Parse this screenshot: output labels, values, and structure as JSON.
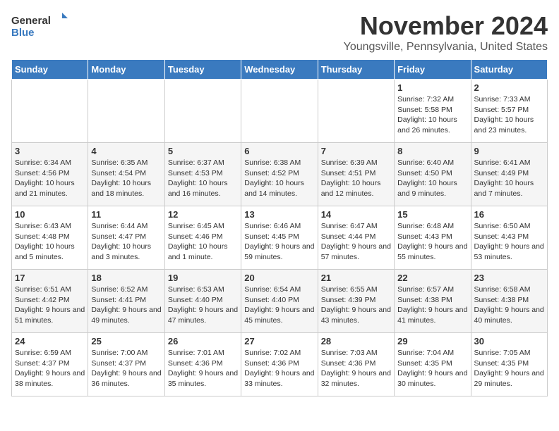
{
  "logo": {
    "general": "General",
    "blue": "Blue"
  },
  "header": {
    "month": "November 2024",
    "location": "Youngsville, Pennsylvania, United States"
  },
  "days_of_week": [
    "Sunday",
    "Monday",
    "Tuesday",
    "Wednesday",
    "Thursday",
    "Friday",
    "Saturday"
  ],
  "weeks": [
    [
      {
        "day": "",
        "info": ""
      },
      {
        "day": "",
        "info": ""
      },
      {
        "day": "",
        "info": ""
      },
      {
        "day": "",
        "info": ""
      },
      {
        "day": "",
        "info": ""
      },
      {
        "day": "1",
        "info": "Sunrise: 7:32 AM\nSunset: 5:58 PM\nDaylight: 10 hours and 26 minutes."
      },
      {
        "day": "2",
        "info": "Sunrise: 7:33 AM\nSunset: 5:57 PM\nDaylight: 10 hours and 23 minutes."
      }
    ],
    [
      {
        "day": "3",
        "info": "Sunrise: 6:34 AM\nSunset: 4:56 PM\nDaylight: 10 hours and 21 minutes."
      },
      {
        "day": "4",
        "info": "Sunrise: 6:35 AM\nSunset: 4:54 PM\nDaylight: 10 hours and 18 minutes."
      },
      {
        "day": "5",
        "info": "Sunrise: 6:37 AM\nSunset: 4:53 PM\nDaylight: 10 hours and 16 minutes."
      },
      {
        "day": "6",
        "info": "Sunrise: 6:38 AM\nSunset: 4:52 PM\nDaylight: 10 hours and 14 minutes."
      },
      {
        "day": "7",
        "info": "Sunrise: 6:39 AM\nSunset: 4:51 PM\nDaylight: 10 hours and 12 minutes."
      },
      {
        "day": "8",
        "info": "Sunrise: 6:40 AM\nSunset: 4:50 PM\nDaylight: 10 hours and 9 minutes."
      },
      {
        "day": "9",
        "info": "Sunrise: 6:41 AM\nSunset: 4:49 PM\nDaylight: 10 hours and 7 minutes."
      }
    ],
    [
      {
        "day": "10",
        "info": "Sunrise: 6:43 AM\nSunset: 4:48 PM\nDaylight: 10 hours and 5 minutes."
      },
      {
        "day": "11",
        "info": "Sunrise: 6:44 AM\nSunset: 4:47 PM\nDaylight: 10 hours and 3 minutes."
      },
      {
        "day": "12",
        "info": "Sunrise: 6:45 AM\nSunset: 4:46 PM\nDaylight: 10 hours and 1 minute."
      },
      {
        "day": "13",
        "info": "Sunrise: 6:46 AM\nSunset: 4:45 PM\nDaylight: 9 hours and 59 minutes."
      },
      {
        "day": "14",
        "info": "Sunrise: 6:47 AM\nSunset: 4:44 PM\nDaylight: 9 hours and 57 minutes."
      },
      {
        "day": "15",
        "info": "Sunrise: 6:48 AM\nSunset: 4:43 PM\nDaylight: 9 hours and 55 minutes."
      },
      {
        "day": "16",
        "info": "Sunrise: 6:50 AM\nSunset: 4:43 PM\nDaylight: 9 hours and 53 minutes."
      }
    ],
    [
      {
        "day": "17",
        "info": "Sunrise: 6:51 AM\nSunset: 4:42 PM\nDaylight: 9 hours and 51 minutes."
      },
      {
        "day": "18",
        "info": "Sunrise: 6:52 AM\nSunset: 4:41 PM\nDaylight: 9 hours and 49 minutes."
      },
      {
        "day": "19",
        "info": "Sunrise: 6:53 AM\nSunset: 4:40 PM\nDaylight: 9 hours and 47 minutes."
      },
      {
        "day": "20",
        "info": "Sunrise: 6:54 AM\nSunset: 4:40 PM\nDaylight: 9 hours and 45 minutes."
      },
      {
        "day": "21",
        "info": "Sunrise: 6:55 AM\nSunset: 4:39 PM\nDaylight: 9 hours and 43 minutes."
      },
      {
        "day": "22",
        "info": "Sunrise: 6:57 AM\nSunset: 4:38 PM\nDaylight: 9 hours and 41 minutes."
      },
      {
        "day": "23",
        "info": "Sunrise: 6:58 AM\nSunset: 4:38 PM\nDaylight: 9 hours and 40 minutes."
      }
    ],
    [
      {
        "day": "24",
        "info": "Sunrise: 6:59 AM\nSunset: 4:37 PM\nDaylight: 9 hours and 38 minutes."
      },
      {
        "day": "25",
        "info": "Sunrise: 7:00 AM\nSunset: 4:37 PM\nDaylight: 9 hours and 36 minutes."
      },
      {
        "day": "26",
        "info": "Sunrise: 7:01 AM\nSunset: 4:36 PM\nDaylight: 9 hours and 35 minutes."
      },
      {
        "day": "27",
        "info": "Sunrise: 7:02 AM\nSunset: 4:36 PM\nDaylight: 9 hours and 33 minutes."
      },
      {
        "day": "28",
        "info": "Sunrise: 7:03 AM\nSunset: 4:36 PM\nDaylight: 9 hours and 32 minutes."
      },
      {
        "day": "29",
        "info": "Sunrise: 7:04 AM\nSunset: 4:35 PM\nDaylight: 9 hours and 30 minutes."
      },
      {
        "day": "30",
        "info": "Sunrise: 7:05 AM\nSunset: 4:35 PM\nDaylight: 9 hours and 29 minutes."
      }
    ]
  ]
}
